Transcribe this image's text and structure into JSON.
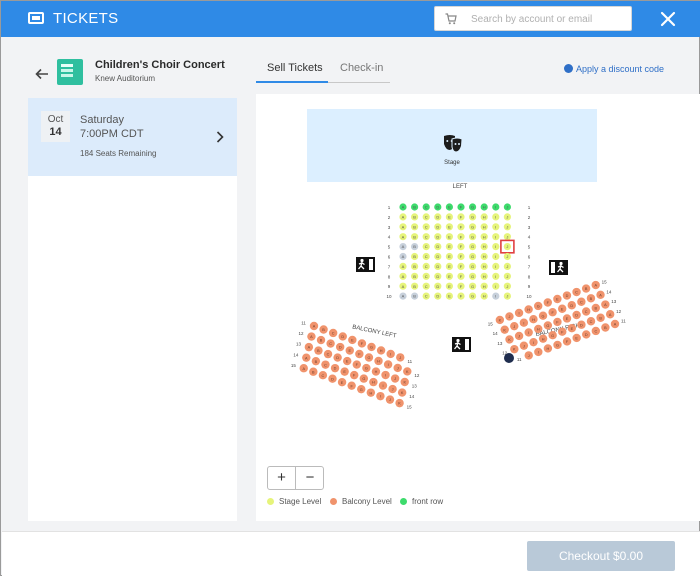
{
  "topbar": {
    "title": "TICKETS",
    "search_placeholder": "Search by account or email"
  },
  "event": {
    "title": "Children's Choir Concert",
    "venue": "Knew Auditorium"
  },
  "tabs": [
    {
      "label": "Sell Tickets",
      "active": true
    },
    {
      "label": "Check-in",
      "active": false
    }
  ],
  "discount_link": "Apply a discount code",
  "date_card": {
    "month": "Oct",
    "day": "14",
    "weekday": "Saturday",
    "time": "7:00PM CDT",
    "remaining": "184 Seats Remaining"
  },
  "seatmap": {
    "stage_label": "Stage",
    "left_label": "LEFT",
    "balcony_left_label": "BALCONY LEFT",
    "balcony_right_label": "BALCONY RIGHT",
    "floor_seat_letters": [
      "A",
      "B",
      "C",
      "D",
      "E",
      "F",
      "G",
      "H",
      "I",
      "J"
    ],
    "floor_row_numbers": [
      1,
      2,
      3,
      4,
      5,
      6,
      7,
      8,
      9,
      10
    ],
    "floor_rows": [
      "GGGGGGGGGG",
      "YYYYYYYYYY",
      "YYYYYYYYYY",
      "YYYYYYYYYY",
      "XXYYYYYYYS",
      "XYYYYYYYYY",
      "YYYYYYYYYY",
      "YYYYYYYYYY",
      "YYYYYYYYYY",
      "XXYYYYYYXY"
    ],
    "balcony_row_numbers": [
      11,
      12,
      13,
      14,
      15
    ],
    "balcony_rows_seat_counts": [
      10,
      11,
      11,
      11,
      11
    ],
    "exit_icons": [
      "exit-left",
      "exit-right",
      "exit-bottom"
    ],
    "colors": {
      "stage_level": "#e6f47a",
      "balcony_level": "#f0936c",
      "front_row": "#3ddb6c",
      "unavailable": "#c7d0db",
      "selected": "#e04040",
      "stage_area": "#dcefff",
      "dark_seat": "#1f2d4e"
    }
  },
  "zoom": {
    "in_label": "+",
    "out_label": "−"
  },
  "legend": [
    {
      "label": "Stage Level",
      "color": "#e6f47a"
    },
    {
      "label": "Balcony Level",
      "color": "#f0936c"
    },
    {
      "label": "front row",
      "color": "#3ddb6c"
    }
  ],
  "checkout": {
    "label": "Checkout  $0.00"
  }
}
